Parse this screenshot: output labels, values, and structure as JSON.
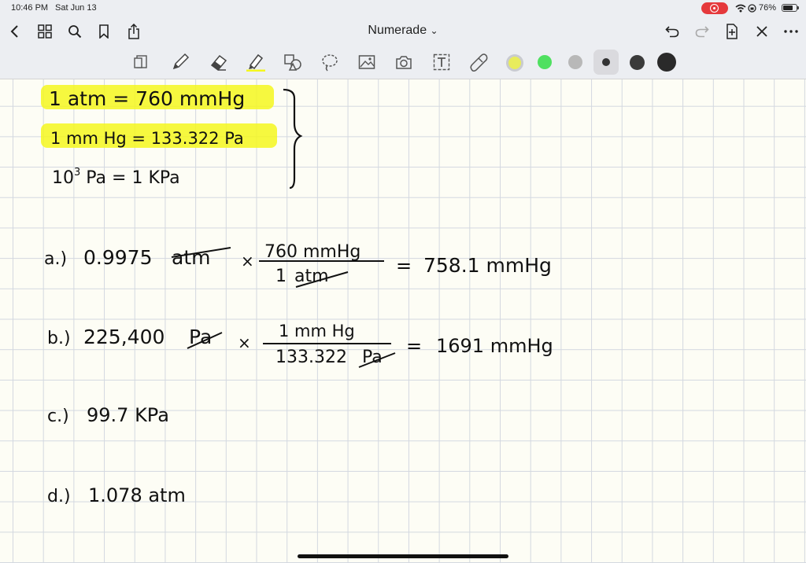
{
  "status_bar": {
    "time": "10:46 PM",
    "date": "Sat Jun 13",
    "battery": "76%",
    "battery_level": 0.76
  },
  "nav": {
    "title": "Numerade",
    "dropdown_glyph": "⌄"
  },
  "toolbar": {
    "tools": [
      "page-view",
      "pen",
      "eraser",
      "highlighter",
      "shapes",
      "lasso",
      "image",
      "camera",
      "text",
      "tape"
    ],
    "colors": {
      "yellow": "#e8ec5c",
      "green": "#4fe060",
      "gray": "#b8b8b8",
      "dark": "#3a3a3a",
      "black": "#2a2a2a",
      "highlight": "#f4f71e"
    }
  },
  "notes": {
    "conv1": "1 atm = 760 mmHg",
    "conv2": "1 mm Hg = 133.322 Pa",
    "conv3_base": "10",
    "conv3_exp": "3",
    "conv3_rest": " Pa = 1 KPa",
    "a": {
      "label": "a.)",
      "value": "0.9975",
      "unit_cancel": "atm",
      "times": "×",
      "num": "760 mmHg",
      "den_1": "1",
      "den_unit": "atm",
      "eq": "=",
      "result": "758.1 mmHg"
    },
    "b": {
      "label": "b.)",
      "value": "225,400",
      "unit_cancel": "Pa",
      "times": "×",
      "num": "1 mm Hg",
      "den_val": "133.322",
      "den_unit": "Pa",
      "eq": "=",
      "result": "1691 mmHg"
    },
    "c": {
      "label": "c.)",
      "value": "99.7 KPa"
    },
    "d": {
      "label": "d.)",
      "value": "1.078 atm"
    }
  }
}
